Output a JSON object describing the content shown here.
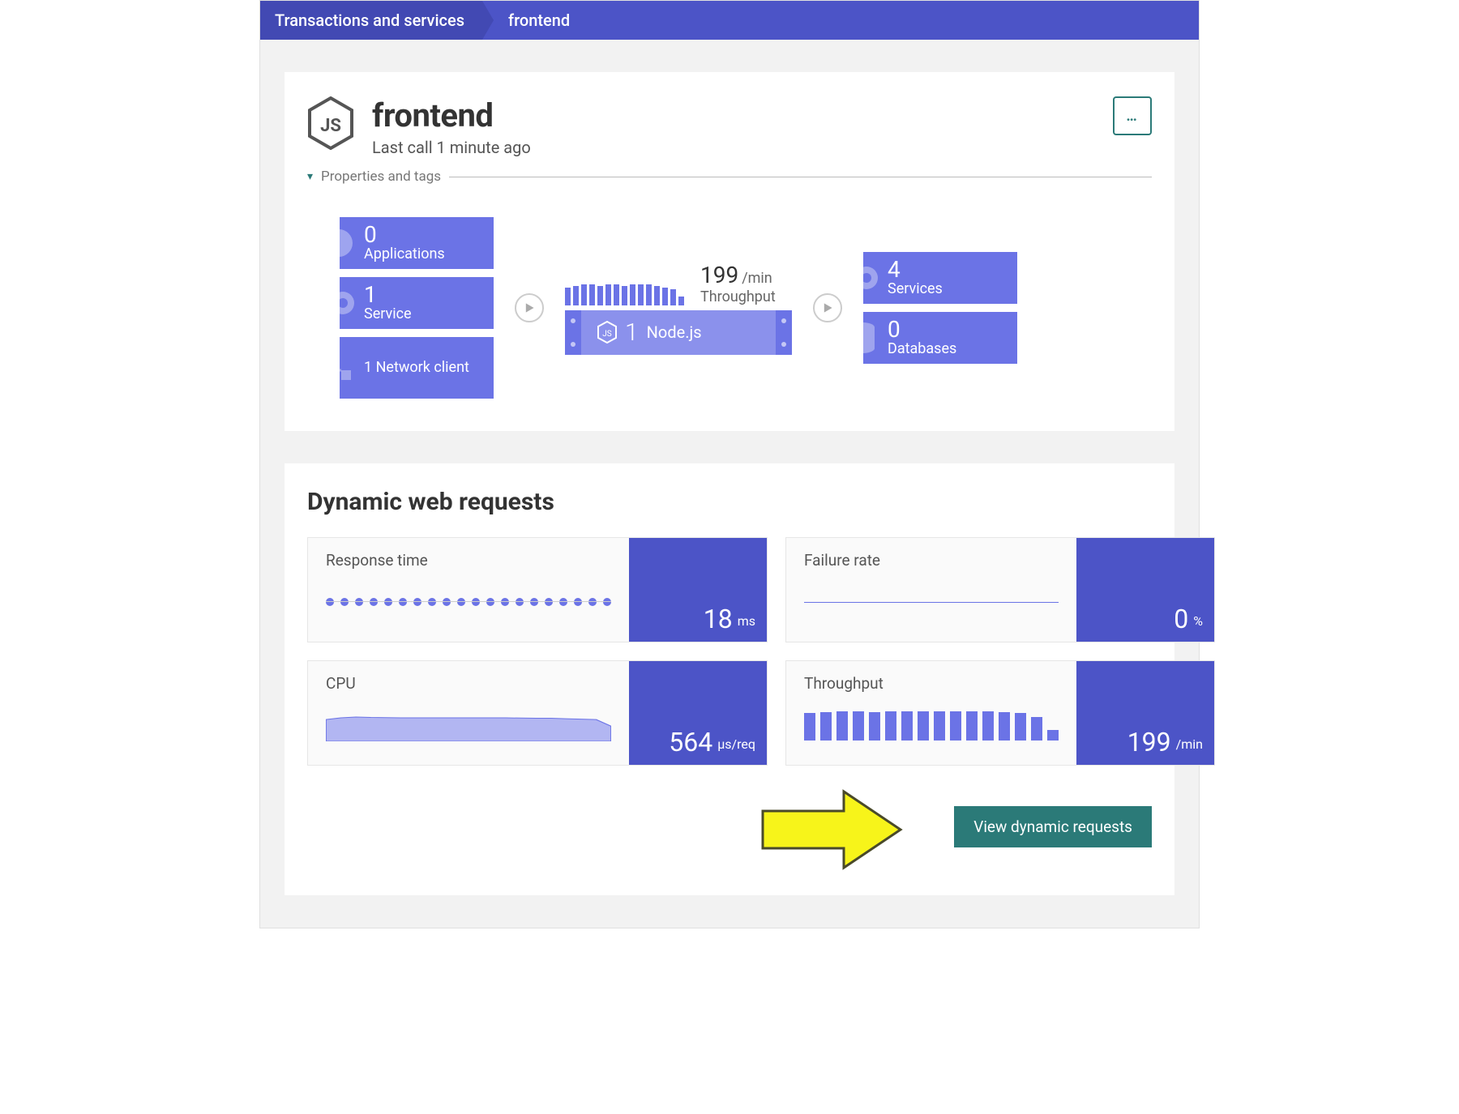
{
  "breadcrumb": {
    "root": "Transactions and services",
    "current": "frontend"
  },
  "header": {
    "title": "frontend",
    "subtitle": "Last call 1 minute ago",
    "properties_toggle": "Properties and tags"
  },
  "flow": {
    "left_tiles": [
      {
        "value": "0",
        "label": "Applications",
        "deco": "user"
      },
      {
        "value": "1",
        "label": "Service",
        "deco": "gear"
      },
      {
        "value": "1",
        "label": "Network client",
        "deco": "net",
        "inline": true
      }
    ],
    "center": {
      "throughput_value": "199",
      "throughput_unit": "/min",
      "throughput_label": "Throughput",
      "node_count": "1",
      "node_name": "Node.js"
    },
    "right_tiles": [
      {
        "value": "4",
        "label": "Services",
        "deco": "gear"
      },
      {
        "value": "0",
        "label": "Databases",
        "deco": "db"
      }
    ]
  },
  "dynamic": {
    "title": "Dynamic web requests",
    "metrics": [
      {
        "name": "Response time",
        "value": "18",
        "unit": "ms",
        "spark": "dots"
      },
      {
        "name": "Failure rate",
        "value": "0",
        "unit": "%",
        "spark": "flat"
      },
      {
        "name": "CPU",
        "value": "564",
        "unit": "µs/req",
        "spark": "area"
      },
      {
        "name": "Throughput",
        "value": "199",
        "unit": "/min",
        "spark": "bars"
      }
    ],
    "cta": "View dynamic requests"
  },
  "chart_data": {
    "throughput_spark_top": {
      "type": "bar",
      "values": [
        20,
        22,
        24,
        24,
        22,
        24,
        24,
        22,
        24,
        24,
        24,
        22,
        20,
        18,
        10
      ],
      "title": "Throughput sparkline",
      "ylabel": "/min"
    },
    "response_time_spark": {
      "type": "line",
      "values": [
        18,
        18,
        18,
        18,
        18,
        18,
        18,
        18,
        18,
        18,
        18,
        18,
        18,
        18,
        18,
        18,
        18,
        18,
        18,
        18
      ],
      "title": "Response time",
      "ylabel": "ms"
    },
    "failure_rate_spark": {
      "type": "line",
      "values": [
        0,
        0,
        0,
        0,
        0,
        0,
        0,
        0,
        0,
        0,
        0,
        0,
        0,
        0,
        0,
        0,
        0,
        0,
        0,
        0
      ],
      "title": "Failure rate",
      "ylabel": "%"
    },
    "cpu_spark": {
      "type": "area",
      "values": [
        520,
        560,
        580,
        570,
        565,
        560,
        560,
        560,
        560,
        560,
        560,
        560,
        560,
        555,
        550,
        550,
        540,
        530,
        520,
        360
      ],
      "title": "CPU",
      "ylabel": "µs/req"
    },
    "throughput_spark_bottom": {
      "type": "bar",
      "values": [
        190,
        195,
        200,
        200,
        195,
        200,
        200,
        200,
        200,
        205,
        200,
        200,
        195,
        190,
        160,
        70
      ],
      "title": "Throughput",
      "ylabel": "/min"
    }
  }
}
